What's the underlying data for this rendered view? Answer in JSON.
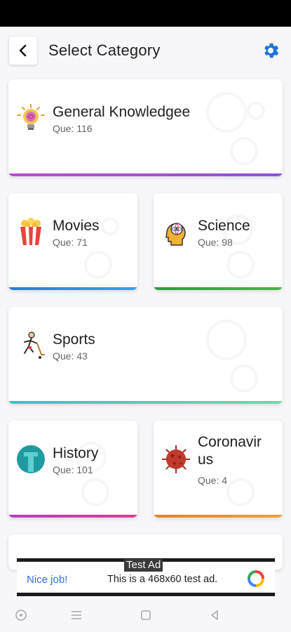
{
  "header": {
    "title": "Select Category"
  },
  "categories": [
    {
      "name": "General Knowledgee",
      "count": "Que: 116",
      "bar_color": "#a64dd6",
      "icon": "brain-bulb-icon"
    },
    {
      "name": "Movies",
      "count": "Que: 71",
      "bar_color": "#2f86d8",
      "icon": "popcorn-icon"
    },
    {
      "name": "Science",
      "count": "Que: 98",
      "bar_color": "#3aa04a",
      "icon": "science-head-icon"
    },
    {
      "name": "Sports",
      "count": "Que: 43",
      "bar_color": "#56c7c0",
      "icon": "hockey-player-icon"
    },
    {
      "name": "History",
      "count": "Que: 101",
      "bar_color": "#cc3fa8",
      "icon": "history-circle-icon"
    },
    {
      "name": "Coronavir\nus",
      "count": "Que: 4",
      "bar_color": "#e58a2b",
      "icon": "virus-icon"
    }
  ],
  "ad": {
    "tag": "Test Ad",
    "left_text": "Nice job!",
    "text": "This is a 468x60 test ad."
  },
  "colors": {
    "accent": "#1a74d8",
    "background": "#f7f7f9"
  }
}
